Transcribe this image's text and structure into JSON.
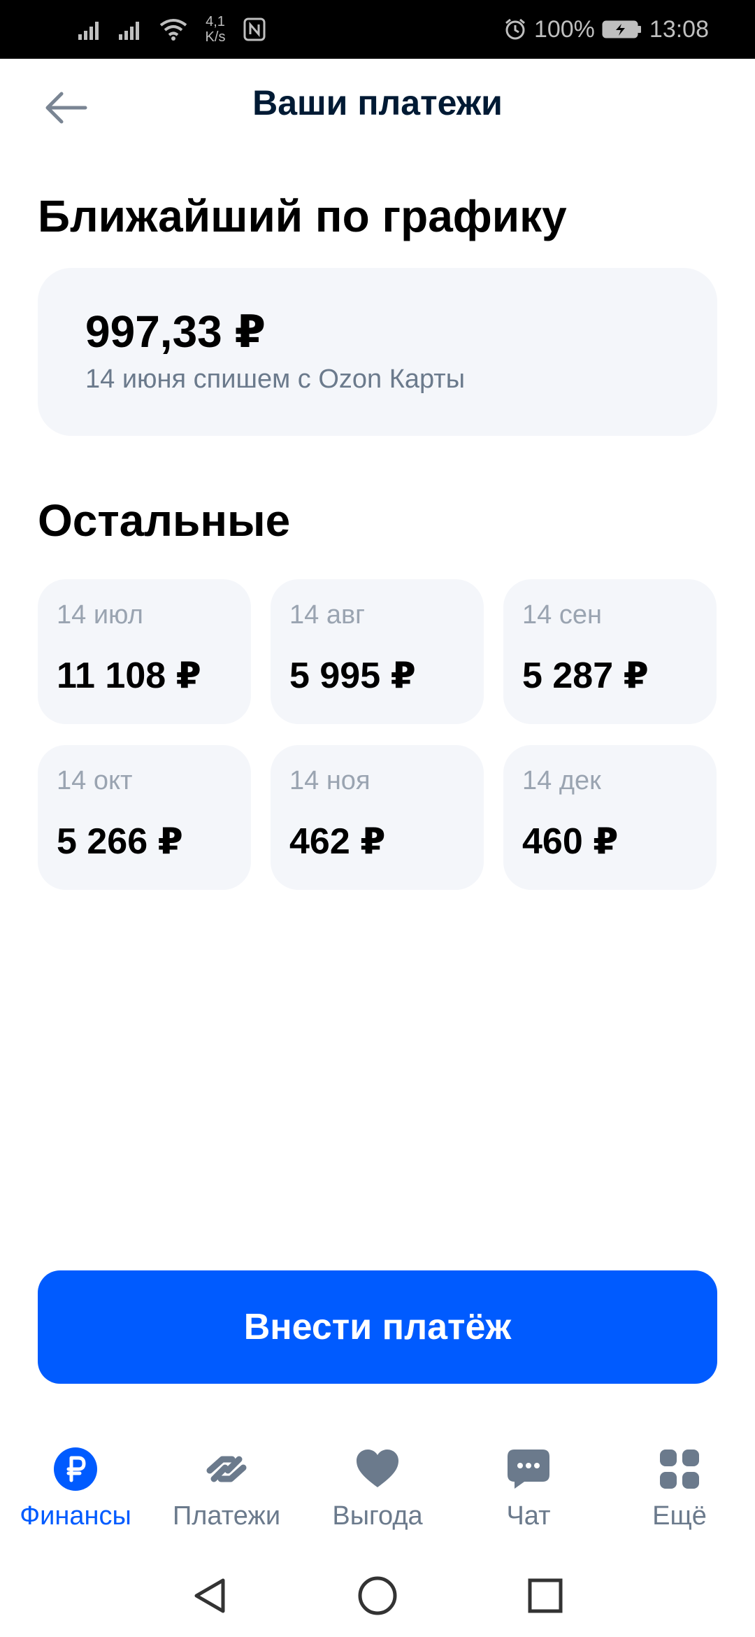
{
  "status_bar": {
    "speed_value": "4,1",
    "speed_unit": "K/s",
    "battery": "100%",
    "time": "13:08"
  },
  "header": {
    "title": "Ваши платежи",
    "back_icon": "arrow-left-icon"
  },
  "upcoming": {
    "heading": "Ближайший по графику",
    "amount": "997,33 ₽",
    "note": "14 июня спишем с Ozon Карты"
  },
  "others": {
    "heading": "Остальные",
    "items": [
      {
        "date": "14 июл",
        "amount": "11 108 ₽"
      },
      {
        "date": "14 авг",
        "amount": "5 995 ₽"
      },
      {
        "date": "14 сен",
        "amount": "5 287 ₽"
      },
      {
        "date": "14 окт",
        "amount": "5 266 ₽"
      },
      {
        "date": "14 ноя",
        "amount": "462 ₽"
      },
      {
        "date": "14 дек",
        "amount": "460 ₽"
      }
    ]
  },
  "primary_button": {
    "label": "Внести платёж"
  },
  "bottom_nav": {
    "items": [
      {
        "label": "Финансы",
        "icon": "ruble-icon",
        "active": true
      },
      {
        "label": "Платежи",
        "icon": "transfer-arrows-icon",
        "active": false
      },
      {
        "label": "Выгода",
        "icon": "heart-icon",
        "active": false
      },
      {
        "label": "Чат",
        "icon": "chat-bubble-icon",
        "active": false
      },
      {
        "label": "Ещё",
        "icon": "grid-icon",
        "active": false
      }
    ]
  },
  "colors": {
    "accent": "#005bff",
    "card_bg": "#f4f6fa",
    "muted_text": "#6b7a8c",
    "nav_icon": "#6b7a8c"
  }
}
